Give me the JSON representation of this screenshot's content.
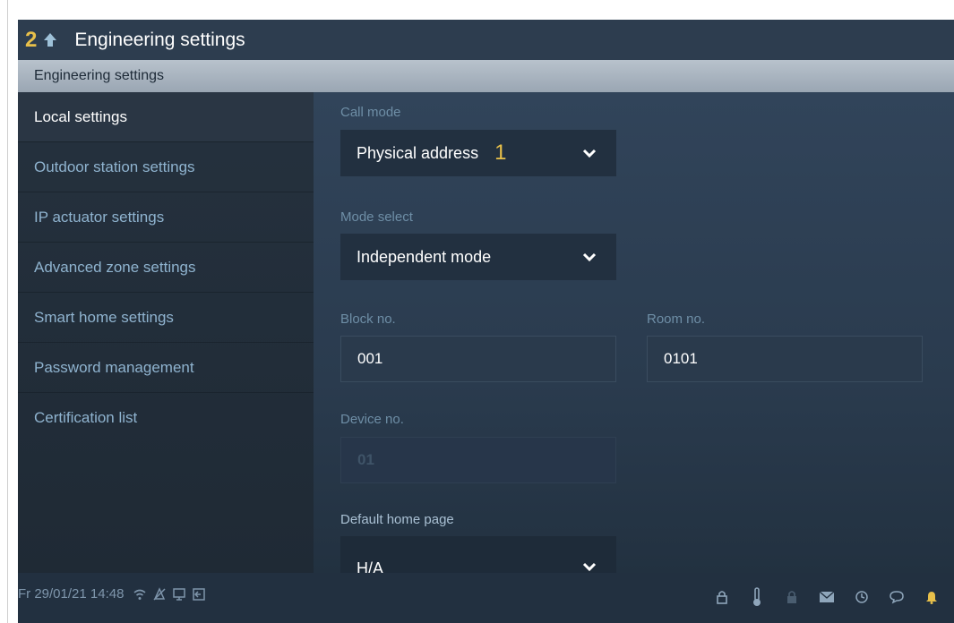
{
  "header": {
    "callout_left": "2",
    "title": "Engineering settings",
    "back_icon": "back-arrow-icon"
  },
  "section": {
    "title": "Engineering settings"
  },
  "sidebar": {
    "items": [
      {
        "label": "Local settings",
        "active": true
      },
      {
        "label": "Outdoor station settings",
        "active": false
      },
      {
        "label": "IP actuator settings",
        "active": false
      },
      {
        "label": "Advanced zone settings",
        "active": false
      },
      {
        "label": "Smart home settings",
        "active": false
      },
      {
        "label": "Password management",
        "active": false
      },
      {
        "label": "Certification list",
        "active": false
      }
    ]
  },
  "form": {
    "call_mode": {
      "label": "Call mode",
      "value": "Physical address",
      "callout": "1"
    },
    "mode_select": {
      "label": "Mode select",
      "value": "Independent mode"
    },
    "block_no": {
      "label": "Block no.",
      "value": "001"
    },
    "room_no": {
      "label": "Room no.",
      "value": "0101"
    },
    "device_no": {
      "label": "Device no.",
      "value": "01"
    },
    "default_home_page": {
      "label": "Default home page",
      "value": "H/A"
    }
  },
  "statusbar": {
    "datetime": "Fr 29/01/21  14:48",
    "left_icons": [
      "wifi-icon",
      "no-disturb-icon",
      "monitor-icon",
      "exit-icon"
    ],
    "right_icons": [
      "lock-icon",
      "thermometer-icon",
      "lock-small-icon",
      "mail-icon",
      "history-icon",
      "message-icon",
      "bell-icon"
    ]
  },
  "colors": {
    "accent_callout": "#e8c04a",
    "background": "#2a394a",
    "text_active": "#ffffff",
    "text_inactive": "#8fb3cf"
  }
}
